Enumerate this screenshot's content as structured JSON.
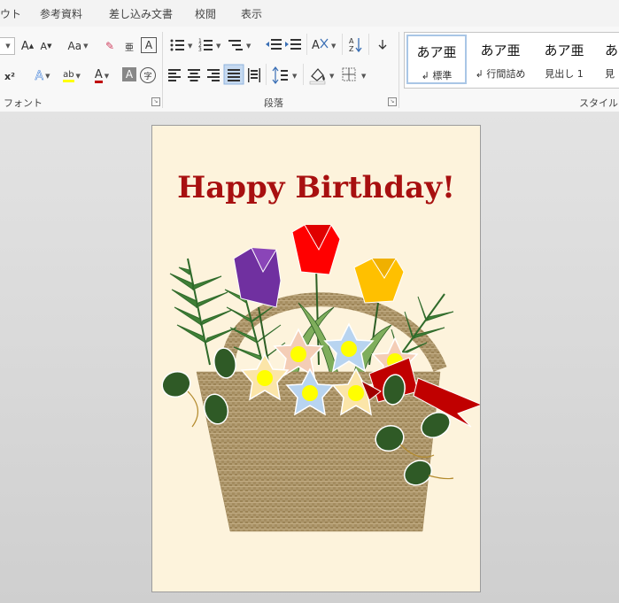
{
  "tabs": [
    "ウト",
    "参考資料",
    "差し込み文書",
    "校閲",
    "表示"
  ],
  "groups": {
    "font": "フォント",
    "paragraph": "段落",
    "styles": "スタイル"
  },
  "styles_gallery": [
    {
      "preview": "あア亜",
      "name": "↲ 標準",
      "selected": true
    },
    {
      "preview": "あア亜",
      "name": "↲ 行間詰め",
      "selected": false
    },
    {
      "preview": "あア亜",
      "name": "見出し 1",
      "selected": false
    },
    {
      "preview": "あ",
      "name": "見",
      "selected": false
    }
  ],
  "ribbon_glyphs": {
    "grow_font": "A",
    "shrink_font": "A",
    "change_case": "Aa",
    "clear_format": "✎",
    "phonetic": "亜",
    "char_border": "A",
    "superscript": "x²",
    "text_effect": "A",
    "highlight": "ab",
    "font_color": "A",
    "char_shading": "A",
    "enclose": "字",
    "asian_layout": "A",
    "sort": "A↓",
    "para_mark": "↵"
  },
  "colors": {
    "highlight": "#ffff00",
    "font_color": "#c00000",
    "title_red": "#a81010",
    "page": "#fdf3dc"
  },
  "document": {
    "title": "Happy Birthday!"
  }
}
